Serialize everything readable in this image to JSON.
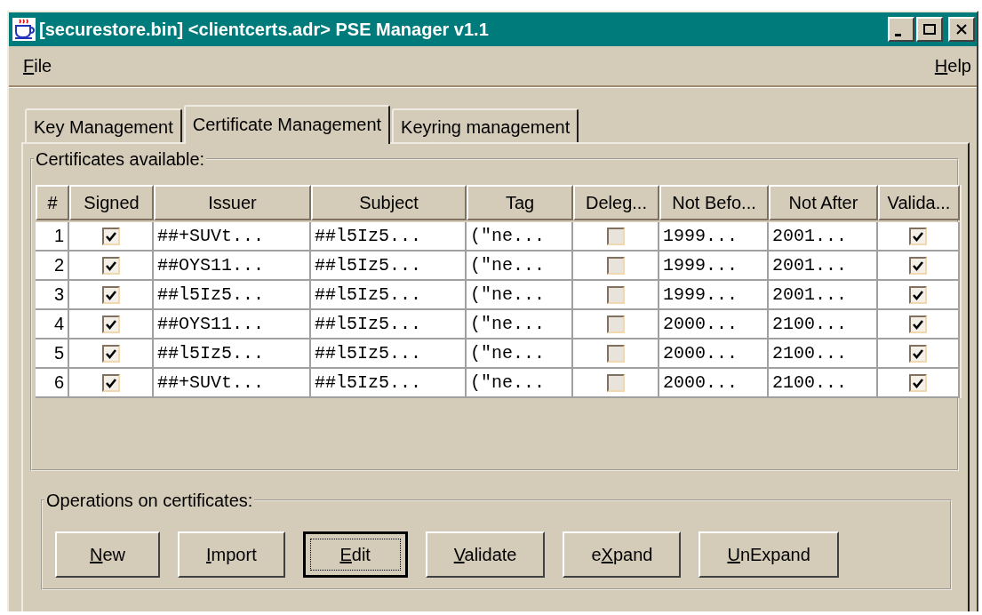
{
  "window": {
    "title": "[securestore.bin] <clientcerts.adr> PSE Manager v1.1"
  },
  "menu": [
    {
      "mnemonic": "F",
      "rest": "ile"
    },
    {
      "mnemonic": "H",
      "rest": "elp"
    }
  ],
  "tabs": [
    {
      "label": "Key Management",
      "selected": false
    },
    {
      "label": "Certificate Management",
      "selected": true
    },
    {
      "label": "Keyring management",
      "selected": false
    }
  ],
  "certificates": {
    "title": "Certificates available:",
    "columns": [
      {
        "label": "#",
        "kind": "number"
      },
      {
        "label": "Signed",
        "kind": "check"
      },
      {
        "label": "Issuer",
        "kind": "text"
      },
      {
        "label": "Subject",
        "kind": "text"
      },
      {
        "label": "Tag",
        "kind": "text"
      },
      {
        "label": "Deleg...",
        "kind": "check"
      },
      {
        "label": "Not Befo...",
        "kind": "text"
      },
      {
        "label": "Not After",
        "kind": "text"
      },
      {
        "label": "Valida...",
        "kind": "check"
      }
    ],
    "rows": [
      {
        "cells": [
          "1",
          true,
          "##+SUVt...",
          "##l5Iz5...",
          "(\"ne...",
          false,
          "1999...",
          "2001...",
          true
        ]
      },
      {
        "cells": [
          "2",
          true,
          "##OYS11...",
          "##l5Iz5...",
          "(\"ne...",
          false,
          "1999...",
          "2001...",
          true
        ]
      },
      {
        "cells": [
          "3",
          true,
          "##l5Iz5...",
          "##l5Iz5...",
          "(\"ne...",
          false,
          "1999...",
          "2001...",
          true
        ]
      },
      {
        "cells": [
          "4",
          true,
          "##OYS11...",
          "##l5Iz5...",
          "(\"ne...",
          false,
          "2000...",
          "2100...",
          true
        ]
      },
      {
        "cells": [
          "5",
          true,
          "##l5Iz5...",
          "##l5Iz5...",
          "(\"ne...",
          false,
          "2000...",
          "2100...",
          true
        ]
      },
      {
        "cells": [
          "6",
          true,
          "##+SUVt...",
          "##l5Iz5...",
          "(\"ne...",
          false,
          "2000...",
          "2100...",
          true
        ]
      }
    ]
  },
  "operations": {
    "title": "Operations on certificates:",
    "buttons": [
      {
        "mnemonic": "N",
        "rest": "ew",
        "focused": false
      },
      {
        "mnemonic": "I",
        "rest": "mport",
        "focused": false
      },
      {
        "mnemonic": "E",
        "rest": "dit",
        "focused": true
      },
      {
        "mnemonic": "V",
        "rest": "alidate",
        "focused": false
      },
      {
        "prefix": "e",
        "mnemonic": "X",
        "rest": "pand",
        "focused": false
      },
      {
        "mnemonic": "U",
        "rest": "nExpand",
        "focused": false
      }
    ]
  }
}
